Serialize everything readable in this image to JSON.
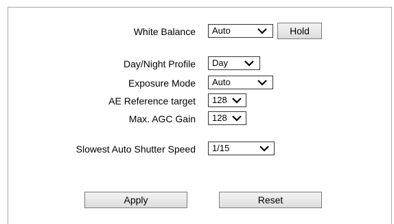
{
  "settings": {
    "white_balance": {
      "label": "White Balance",
      "value": "Auto",
      "hold_label": "Hold"
    },
    "day_night_profile": {
      "label": "Day/Night Profile",
      "value": "Day"
    },
    "exposure_mode": {
      "label": "Exposure Mode",
      "value": "Auto"
    },
    "ae_reference_target": {
      "label": "AE Reference target",
      "value": "128"
    },
    "max_agc_gain": {
      "label": "Max. AGC Gain",
      "value": "128"
    },
    "slowest_auto_shutter_speed": {
      "label": "Slowest Auto Shutter Speed",
      "value": "1/15"
    }
  },
  "actions": {
    "apply_label": "Apply",
    "reset_label": "Reset"
  },
  "colors": {
    "panel_border": "#a6a6a6",
    "select_border": "#333333",
    "button_border": "#7a7a7a"
  }
}
